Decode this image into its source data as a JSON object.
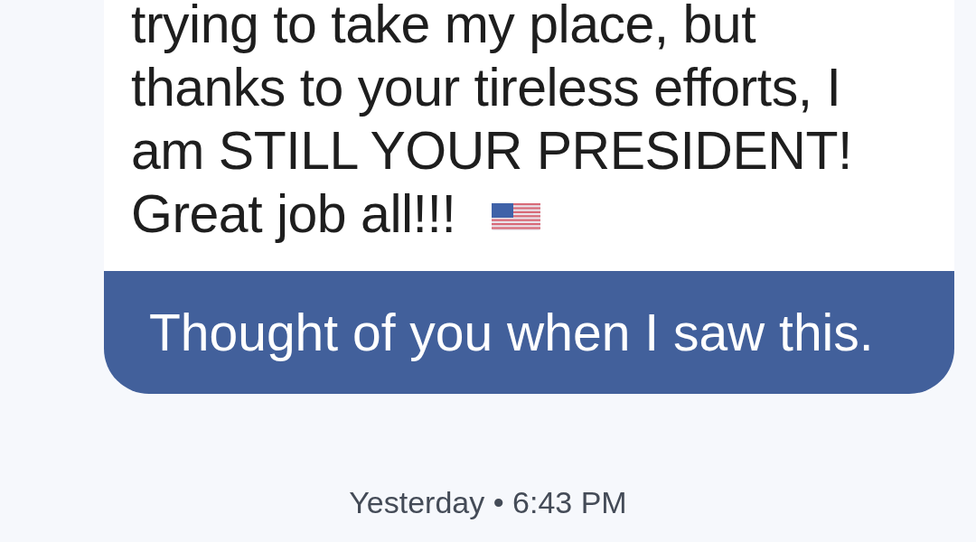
{
  "message": {
    "attachment": {
      "lines": [
        "trying to take my place, but",
        "thanks to your tireless efforts, I",
        "am STILL YOUR PRESIDENT!",
        "Great job all!!!"
      ]
    },
    "caption": "Thought of you when I saw this."
  },
  "timestamp": "Yesterday • 6:43 PM"
}
